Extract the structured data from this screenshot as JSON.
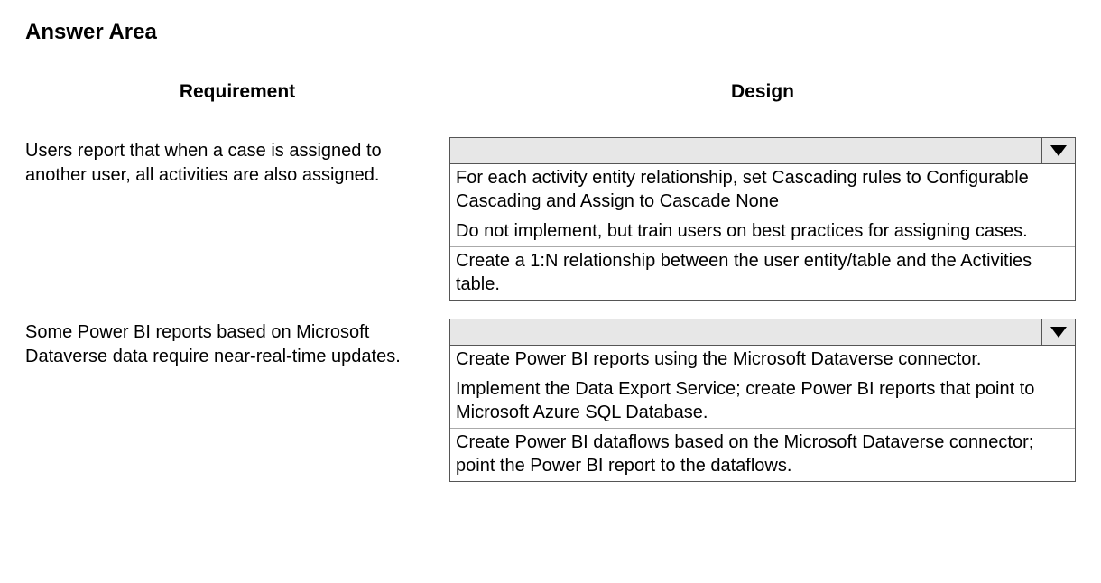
{
  "title": "Answer Area",
  "headers": {
    "requirement": "Requirement",
    "design": "Design"
  },
  "rows": [
    {
      "requirement": "Users report that when a case is assigned to another user, all activities are also assigned.",
      "options": [
        "For each activity entity relationship, set Cascading rules to Configurable Cascading and Assign to Cascade None",
        "Do not implement, but train users on best practices for assigning cases.",
        "Create a 1:N relationship between the user entity/table and the Activities table."
      ]
    },
    {
      "requirement": "Some Power BI reports based on Microsoft Dataverse data require near-real-time updates.",
      "options": [
        "Create Power BI reports using the Microsoft Dataverse connector.",
        "Implement the Data Export Service; create Power BI reports that point to Microsoft Azure SQL Database.",
        "Create Power BI dataflows based on the Microsoft Dataverse connector; point the Power BI report to the dataflows."
      ]
    }
  ]
}
